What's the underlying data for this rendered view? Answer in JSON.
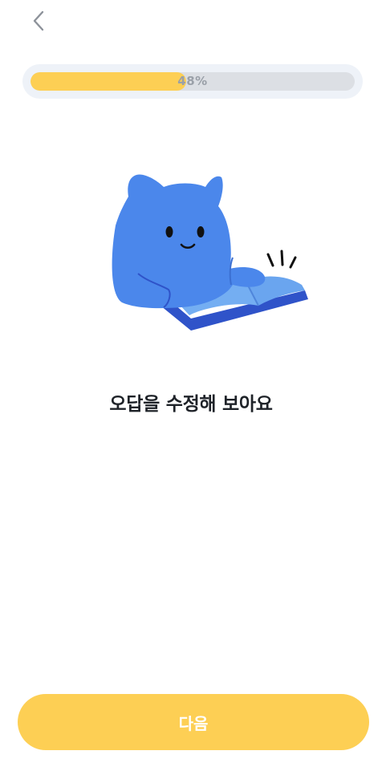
{
  "header": {
    "back_icon": "chevron-left-icon"
  },
  "progress": {
    "value": 0.48,
    "label": "48%"
  },
  "illustration": {
    "subject": "blue-cat-reading-book",
    "colors": {
      "body": "#4b87eb",
      "book_cover": "#2f53c9",
      "book_pages": "#74aef2"
    }
  },
  "main": {
    "message": "오답을 수정해 보아요"
  },
  "footer": {
    "next_label": "다음"
  },
  "colors": {
    "accent": "#fdcf54",
    "track": "#dcdfe4",
    "track_bg": "#eef2f8",
    "text": "#1e2228"
  }
}
